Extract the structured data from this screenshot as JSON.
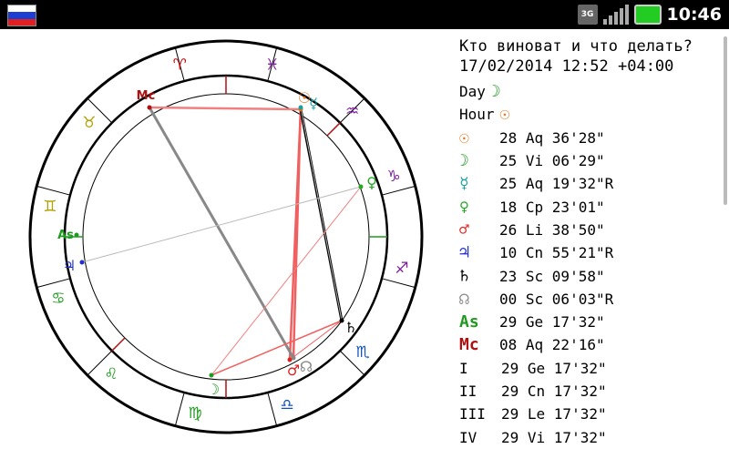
{
  "status_bar": {
    "time": "10:46",
    "network": "3G",
    "flag_colors": [
      "#ffffff",
      "#1c3fd1",
      "#e02020"
    ]
  },
  "header": {
    "question": "Кто виноват и что делать?",
    "datetime": "17/02/2014 12:52 +04:00"
  },
  "rulers": [
    {
      "label": "Day",
      "glyph": "☽",
      "color": "#1f9a1f"
    },
    {
      "label": "Hour",
      "glyph": "☉",
      "color": "#f07010"
    }
  ],
  "planets": [
    {
      "glyph": "☉",
      "color": "#f07010",
      "text": "28 Aq 36'28\""
    },
    {
      "glyph": "☽",
      "color": "#1f9a1f",
      "text": "25 Vi 06'29\""
    },
    {
      "glyph": "☿",
      "color": "#1aa0a0",
      "text": "25 Aq 19'32\"R"
    },
    {
      "glyph": "♀",
      "color": "#22aa22",
      "text": "18 Cp 23'01\""
    },
    {
      "glyph": "♂",
      "color": "#e02020",
      "text": "26 Li 38'50\""
    },
    {
      "glyph": "♃",
      "color": "#2030d0",
      "text": "10 Cn 55'21\"R"
    },
    {
      "glyph": "♄",
      "color": "#000000",
      "text": "23 Sc 09'58\""
    },
    {
      "glyph": "☊",
      "color": "#888888",
      "text": "00 Sc 06'03\"R"
    },
    {
      "glyph": "As",
      "color": "#1f9a1f",
      "text": "29 Ge 17'32\""
    },
    {
      "glyph": "Mc",
      "color": "#b01010",
      "text": "08 Aq 22'16\""
    }
  ],
  "houses": [
    {
      "label": "I",
      "text": "29 Ge 17'32\""
    },
    {
      "label": "II",
      "text": "29 Cn 17'32\""
    },
    {
      "label": "III",
      "text": "29 Le 17'32\""
    },
    {
      "label": "IV",
      "text": "29 Vi 17'32\""
    }
  ],
  "zodiac_glyphs": [
    {
      "glyph": "♈",
      "color": "#c01010"
    },
    {
      "glyph": "♓",
      "color": "#8020a0"
    },
    {
      "glyph": "♒",
      "color": "#8020a0"
    },
    {
      "glyph": "♑",
      "color": "#8020a0"
    },
    {
      "glyph": "♐",
      "color": "#8020a0"
    },
    {
      "glyph": "♏",
      "color": "#1050c0"
    },
    {
      "glyph": "♎",
      "color": "#1050c0"
    },
    {
      "glyph": "♍",
      "color": "#1f9a1f"
    },
    {
      "glyph": "♌",
      "color": "#1f9a1f"
    },
    {
      "glyph": "♋",
      "color": "#1f9a1f"
    },
    {
      "glyph": "♊",
      "color": "#b0a000"
    },
    {
      "glyph": "♉",
      "color": "#b0a000"
    }
  ],
  "wheel_points": [
    {
      "name": "sun",
      "glyph": "☉",
      "color": "#f07010"
    },
    {
      "name": "mercury",
      "glyph": "☿",
      "color": "#1aa0a0"
    },
    {
      "name": "venus",
      "glyph": "♀",
      "color": "#22aa22"
    },
    {
      "name": "saturn",
      "glyph": "♄",
      "color": "#000000"
    },
    {
      "name": "node",
      "glyph": "☊",
      "color": "#888888"
    },
    {
      "name": "mars",
      "glyph": "♂",
      "color": "#e02020"
    },
    {
      "name": "moon",
      "glyph": "☽",
      "color": "#1f9a1f"
    },
    {
      "name": "jupiter",
      "glyph": "♃",
      "color": "#2030d0"
    },
    {
      "name": "ascendant",
      "glyph": "As",
      "color": "#1f9a1f"
    },
    {
      "name": "midheaven",
      "glyph": "Mc",
      "color": "#b01010"
    }
  ]
}
